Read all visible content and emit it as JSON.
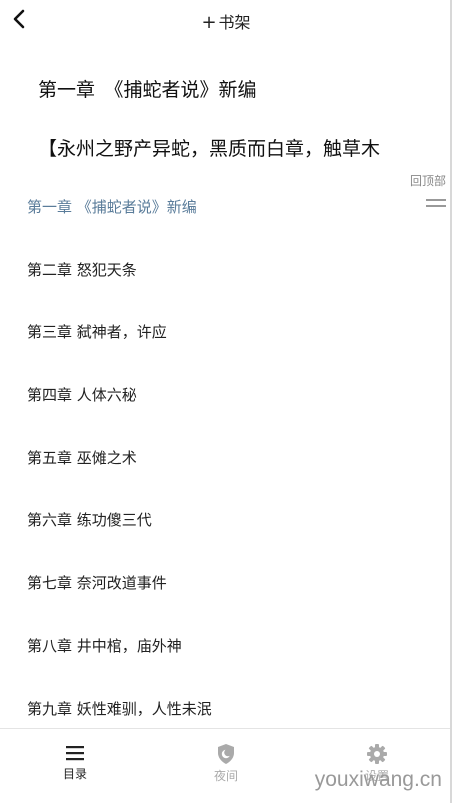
{
  "header": {
    "back_icon": "chevron-left-icon",
    "shelf_plus": "+",
    "shelf_label": "书架"
  },
  "reader": {
    "chapter_title": "第一章　《捕蛇者说》新编",
    "first_line": "【永州之野产异蛇，黑质而白章，触草木"
  },
  "back_to_top": "回顶部",
  "toc": {
    "items": [
      "第一章 《捕蛇者说》新编",
      "第二章 怒犯天条",
      "第三章 弑神者，许应",
      "第四章 人体六秘",
      "第五章 巫傩之术",
      "第六章 练功傻三代",
      "第七章 奈河改道事件",
      "第八章 井中棺，庙外神",
      "第九章 妖性难驯，人性未泯"
    ],
    "current_index": 0,
    "current_color": "#5a7c9a"
  },
  "bottom_bar": {
    "tabs": [
      {
        "label": "目录",
        "icon": "menu-icon",
        "active": true
      },
      {
        "label": "夜间",
        "icon": "shield-moon-icon",
        "active": false
      },
      {
        "label": "设置",
        "icon": "gear-icon",
        "active": false
      }
    ]
  },
  "watermark": "youxiwang.cn"
}
